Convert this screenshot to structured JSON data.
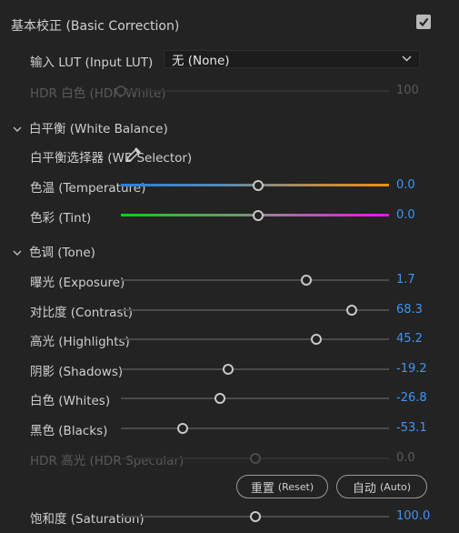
{
  "header": {
    "title": "基本校正 (Basic Correction)",
    "enabled": true
  },
  "input_lut": {
    "label": "输入 LUT (Input LUT)",
    "value": "无 (None)"
  },
  "hdr_white": {
    "label": "HDR 白色 (HDR White)",
    "value": "100",
    "level": 0.0
  },
  "white_balance": {
    "section_label": "白平衡 (White Balance)",
    "selector_label": "白平衡选择器 (WB Selector)",
    "temperature": {
      "label": "色温 (Temperature)",
      "value": "0.0",
      "level": 0.5
    },
    "tint": {
      "label": "色彩 (Tint)",
      "value": "0.0",
      "level": 0.5
    }
  },
  "tone": {
    "section_label": "色调 (Tone)",
    "sliders": [
      {
        "label": "曝光 (Exposure)",
        "value": "1.7",
        "level": 0.69,
        "disabled": false
      },
      {
        "label": "对比度 (Contrast)",
        "value": "68.3",
        "level": 0.86,
        "disabled": false
      },
      {
        "label": "高光 (Highlights)",
        "value": "45.2",
        "level": 0.73,
        "disabled": false
      },
      {
        "label": "阴影 (Shadows)",
        "value": "-19.2",
        "level": 0.4,
        "disabled": false
      },
      {
        "label": "白色 (Whites)",
        "value": "-26.8",
        "level": 0.37,
        "disabled": false
      },
      {
        "label": "黑色 (Blacks)",
        "value": "-53.1",
        "level": 0.23,
        "disabled": false
      },
      {
        "label": "HDR 高光 (HDR Specular)",
        "value": "0.0",
        "level": 0.5,
        "disabled": true
      }
    ],
    "reset_label": "重置",
    "reset_sub": "(Reset)",
    "auto_label": "自动",
    "auto_sub": "(Auto)"
  },
  "saturation": {
    "label": "饱和度 (Saturation)",
    "value": "100.0",
    "level": 0.5
  },
  "colors": {
    "accent": "#3e96f0",
    "background": "#232323"
  }
}
